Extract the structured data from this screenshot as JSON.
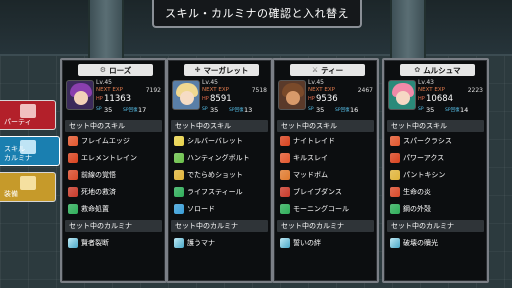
{
  "window_title": "スキル・カルミナの確認と入れ替え",
  "side_menu": [
    {
      "label": "パーティ",
      "bg": "#b3202a"
    },
    {
      "label": "スキル\nカルミナ",
      "bg": "#1a7fb0"
    },
    {
      "label": "装備",
      "bg": "#c69a2a"
    }
  ],
  "labels": {
    "next_exp": "NEXT EXP",
    "hp": "HP",
    "sp": "SP",
    "sp_cost": "SP回復",
    "skills_header": "セット中のスキル",
    "carumina_header": "セット中のカルミナ"
  },
  "characters": [
    {
      "name": "ローズ",
      "symbol": "⚙",
      "level": "Lv.45",
      "next_exp": "7192",
      "hp": "11363",
      "sp": "35",
      "sp_regen": "17",
      "avatar": {
        "bg": "#3b2a5a",
        "hair": "#8a3fae",
        "face": "#f2d2b8"
      },
      "skills": [
        {
          "name": "フレイムエッジ",
          "color": "#e2572e"
        },
        {
          "name": "エレメントレイン",
          "color": "#d8431f"
        },
        {
          "name": "前線の覚悟",
          "color": "#d94a2a"
        },
        {
          "name": "死地の救済",
          "color": "#c83a2a"
        },
        {
          "name": "救命処置",
          "color": "#2fae5a"
        }
      ],
      "carumina": "賢者裂断"
    },
    {
      "name": "マーガレット",
      "symbol": "✚",
      "level": "Lv.45",
      "next_exp": "7518",
      "hp": "8591",
      "sp": "35",
      "sp_regen": "13",
      "avatar": {
        "bg": "#5a7fa8",
        "hair": "#f0d890",
        "face": "#f6dcc4"
      },
      "skills": [
        {
          "name": "シルバーバレット",
          "color": "#e8d24a"
        },
        {
          "name": "ハンティングボルト",
          "color": "#6bc04a"
        },
        {
          "name": "でたらめショット",
          "color": "#e0b43a"
        },
        {
          "name": "ライフスティール",
          "color": "#2fae5a"
        },
        {
          "name": "ソロード",
          "color": "#3a9ed8"
        }
      ],
      "carumina": "護うマナ"
    },
    {
      "name": "ティー",
      "symbol": "⚔",
      "level": "Lv.45",
      "next_exp": "2467",
      "hp": "9536",
      "sp": "35",
      "sp_regen": "16",
      "avatar": {
        "bg": "#5a3a2a",
        "hair": "#7a4a2a",
        "face": "#d89a6a"
      },
      "skills": [
        {
          "name": "ナイトレイド",
          "color": "#d8431f"
        },
        {
          "name": "キルスレイ",
          "color": "#e2572e"
        },
        {
          "name": "マッドボム",
          "color": "#e07a2e"
        },
        {
          "name": "ブレイブダンス",
          "color": "#c83a2a"
        },
        {
          "name": "モーニングコール",
          "color": "#2fae5a"
        }
      ],
      "carumina": "誓いの絆"
    },
    {
      "name": "ムルシュマ",
      "symbol": "✿",
      "level": "Lv.43",
      "next_exp": "2223",
      "hp": "10684",
      "sp": "35",
      "sp_regen": "14",
      "avatar": {
        "bg": "#2a8a7a",
        "hair": "#f08aa8",
        "face": "#f6d8c4"
      },
      "skills": [
        {
          "name": "スパークラシス",
          "color": "#e2572e"
        },
        {
          "name": "パワーアクス",
          "color": "#d8431f"
        },
        {
          "name": "パントキシン",
          "color": "#e0b43a"
        },
        {
          "name": "生命の炎",
          "color": "#d94a2a"
        },
        {
          "name": "鋼の外殻",
          "color": "#2fae5a"
        }
      ],
      "carumina": "破壊の贖光"
    }
  ]
}
